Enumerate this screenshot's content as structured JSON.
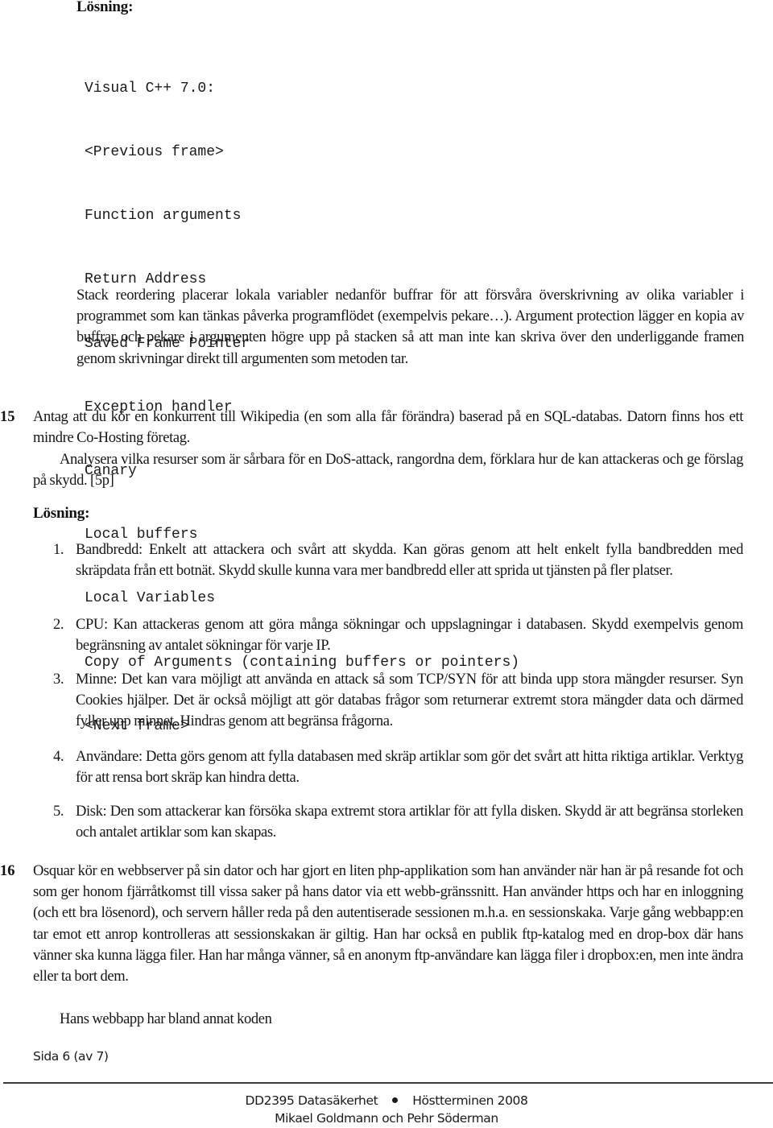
{
  "section_top": {
    "heading": "Lösning:",
    "code_lines": [
      "Visual C++ 7.0:",
      "<Previous frame>",
      "Function arguments",
      "Return Address",
      "Saved Frame Pointer",
      "Exception handler",
      "Canary",
      "Local buffers",
      "Local Variables",
      "Copy of Arguments (containing buffers or pointers)",
      "<Next frame>"
    ],
    "explanation": "Stack reordering placerar lokala variabler nedanför buffrar för att försvåra överskrivning av olika variabler i programmet som kan tänkas påverka programflödet (exempelvis pekare…). Argument protection lägger en kopia av buffrar och pekare i argumenten högre upp på stacken så att man inte kan skriva över den underliggande framen genom skrivningar direkt till argumenten som metoden tar."
  },
  "question_15": {
    "number": "15",
    "text": "Antag att du kör en konkurrent till Wikipedia (en som alla får förändra) baserad på en SQL-databas. Datorn finns hos ett mindre Co-Hosting företag.",
    "task": "Analysera vilka resurser som är sårbara för en DoS-attack, rangordna dem, förklara hur de kan attackeras och ge förslag på skydd. [5p]",
    "solution_heading": "Lösning:",
    "solution_items": [
      {
        "number": "1.",
        "text": "Bandbredd: Enkelt att attackera och svårt att skydda. Kan göras genom att helt enkelt fylla bandbredden med skräpdata från ett botnät. Skydd skulle kunna vara mer bandbredd eller att sprida ut tjänsten på fler platser."
      },
      {
        "number": "2.",
        "text": "CPU: Kan attackeras genom att göra många sökningar och uppslagningar i databasen. Skydd exempelvis genom begränsning av antalet sökningar för varje IP."
      },
      {
        "number": "3.",
        "text": "Minne: Det kan vara möjligt att använda en attack så som TCP/SYN för att binda upp stora mängder resurser. Syn Cookies hjälper. Det är också möjligt att gör databas frågor som returnerar extremt stora mängder data och därmed fyller upp minnet. Hindras genom att begränsa frågorna."
      },
      {
        "number": "4.",
        "text": "Användare: Detta görs genom att fylla databasen med skräp artiklar som gör det svårt att hitta riktiga artiklar. Verktyg för att rensa bort skräp kan hindra detta."
      },
      {
        "number": "5.",
        "text": "Disk: Den som attackerar kan försöka skapa extremt stora artiklar för att fylla disken. Skydd är att begränsa storleken och antalet artiklar som kan skapas."
      }
    ]
  },
  "question_16": {
    "number": "16",
    "text": "Osquar kör en webbserver på sin dator och har gjort en liten php-applikation som han använder när han är på resande fot och som ger honom fjärråtkomst till vissa saker på hans dator via ett webb-gränssnitt. Han använder https och har en inloggning (och ett bra lösenord), och servern håller reda på den autentiserade sessionen m.h.a. en sessionskaka. Varje gång webbapp:en tar emot ett anrop kontrolleras att sessionskakan är giltig. Han har också en publik ftp-katalog med en drop-box där hans vänner ska kunna lägga filer. Han har många vänner, så en anonym ftp-användare kan lägga filer i dropbox:en, men inte ändra eller ta bort dem.",
    "followup": "Hans webbapp har bland annat koden"
  },
  "page": {
    "page_number": "Sida 6 (av 7)"
  },
  "footer": {
    "course": "DD2395 Datasäkerhet",
    "term": "Höstterminen 2008",
    "authors": "Mikael Goldmann och Pehr Söderman"
  }
}
